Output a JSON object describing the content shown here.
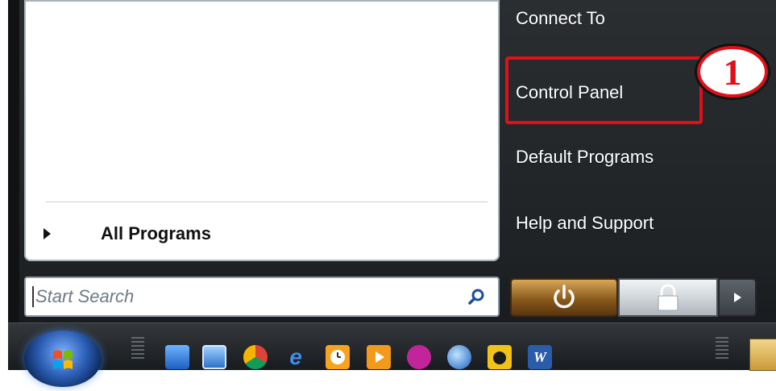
{
  "start_menu": {
    "left_panel": {
      "all_programs_label": "All Programs"
    },
    "search": {
      "placeholder": "Start Search"
    },
    "right_panel": {
      "items": [
        {
          "label": "Connect To"
        },
        {
          "label": "Control Panel"
        },
        {
          "label": "Default Programs"
        },
        {
          "label": "Help and Support"
        }
      ]
    },
    "annotation": {
      "step_number": "1",
      "color": "#e01018"
    }
  },
  "taskbar": {
    "quick_launch_icons": [
      "show-desktop-icon",
      "switch-windows-icon",
      "chrome-icon",
      "internet-explorer-icon",
      "clock-icon",
      "media-player-icon",
      "headphones-icon",
      "google-earth-icon",
      "app-icon",
      "word-icon"
    ]
  }
}
